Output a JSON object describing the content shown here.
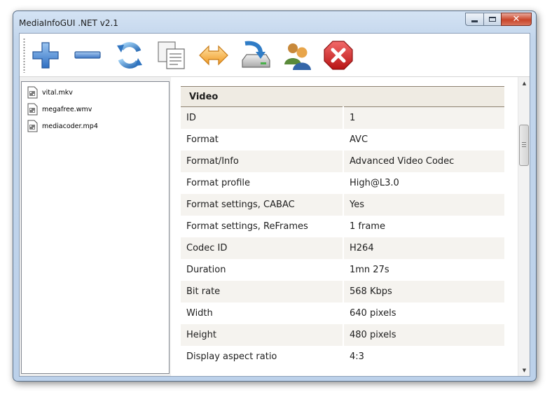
{
  "window": {
    "title": "MediaInfoGUI .NET v2.1",
    "controls": {
      "close_glyph": "✕"
    }
  },
  "toolbar": {
    "buttons": [
      {
        "name": "add-button",
        "icon": "plus-icon"
      },
      {
        "name": "remove-button",
        "icon": "minus-icon"
      },
      {
        "name": "refresh-button",
        "icon": "refresh-icon"
      },
      {
        "name": "copy-button",
        "icon": "copy-icon"
      },
      {
        "name": "compare-button",
        "icon": "double-arrow-icon"
      },
      {
        "name": "export-button",
        "icon": "save-drive-icon"
      },
      {
        "name": "about-button",
        "icon": "users-icon"
      },
      {
        "name": "exit-button",
        "icon": "close-stop-icon"
      }
    ]
  },
  "files": [
    {
      "name": "vital.mkv"
    },
    {
      "name": "megafree.wmv"
    },
    {
      "name": "mediacoder.mp4"
    }
  ],
  "info": {
    "section": "Video",
    "rows": [
      {
        "label": "ID",
        "value": "1"
      },
      {
        "label": "Format",
        "value": "AVC"
      },
      {
        "label": "Format/Info",
        "value": "Advanced Video Codec"
      },
      {
        "label": "Format profile",
        "value": "High@L3.0"
      },
      {
        "label": "Format settings, CABAC",
        "value": "Yes"
      },
      {
        "label": "Format settings, ReFrames",
        "value": "1 frame"
      },
      {
        "label": "Codec ID",
        "value": "H264"
      },
      {
        "label": "Duration",
        "value": "1mn 27s"
      },
      {
        "label": "Bit rate",
        "value": "568 Kbps"
      },
      {
        "label": "Width",
        "value": "640 pixels"
      },
      {
        "label": "Height",
        "value": "480 pixels"
      },
      {
        "label": "Display aspect ratio",
        "value": "4:3"
      }
    ]
  },
  "scrollbar": {
    "up_glyph": "▲",
    "down_glyph": "▼"
  },
  "colors": {
    "plus": "#3c7fd0",
    "minus": "#5b8fd2",
    "refresh": "#3d82c8",
    "arrows": "#f0a030",
    "stop": "#d42a2a",
    "row_alt": "#f5f3ef",
    "header_bg": "#efebe3"
  }
}
